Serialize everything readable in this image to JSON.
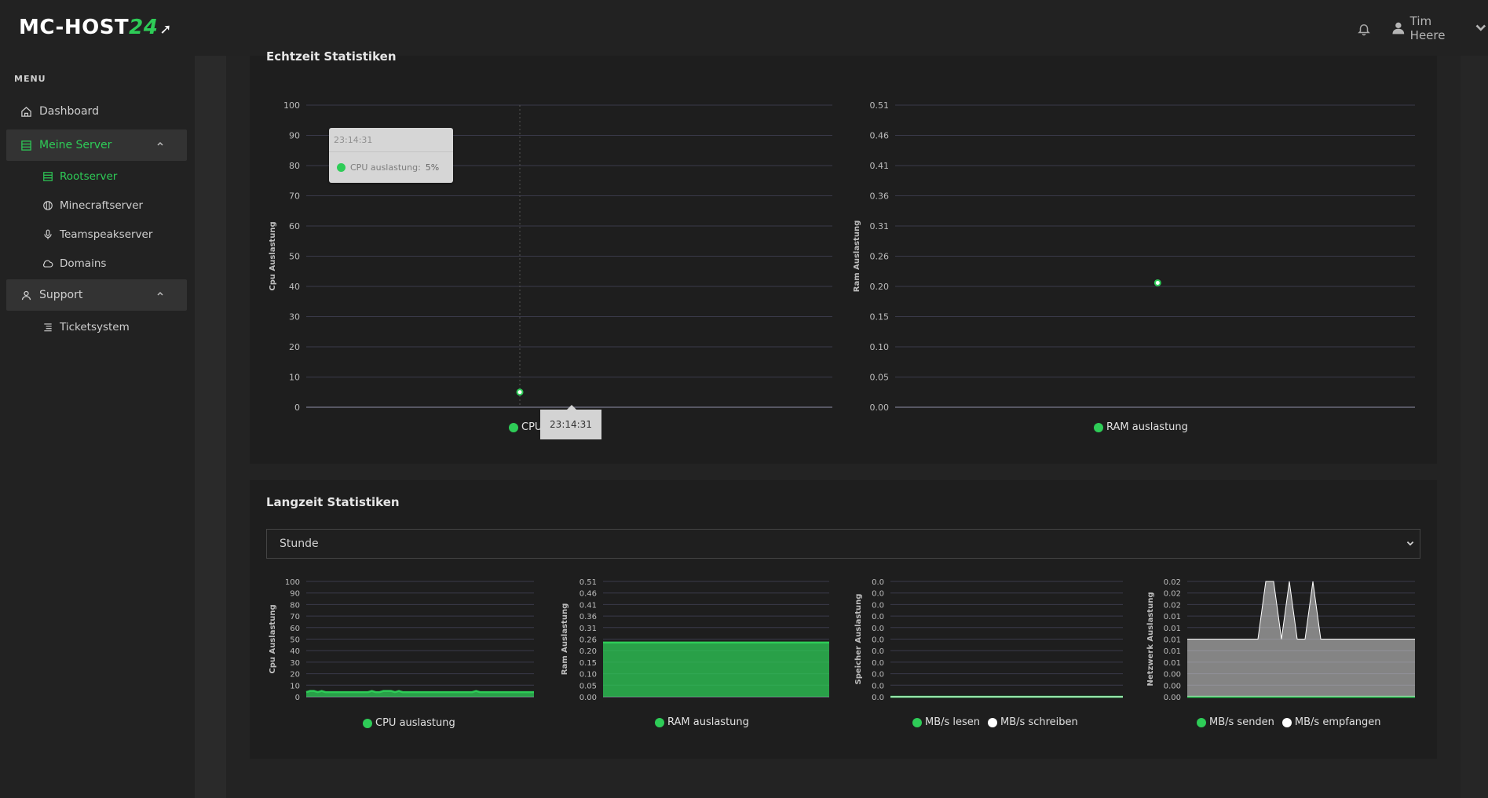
{
  "header": {
    "logo_text": "MC-HOST",
    "logo_accent": "24",
    "user_name": "Tim Heere",
    "icons": [
      "bell-icon",
      "user-icon",
      "chevron-down-icon"
    ]
  },
  "sidebar": {
    "menu_label": "MENU",
    "items": [
      {
        "label": "Dashboard",
        "icon": "home-icon"
      },
      {
        "label": "Meine Server",
        "icon": "server-icon"
      },
      {
        "label": "Rootserver",
        "icon": "server-icon"
      },
      {
        "label": "Minecraftserver",
        "icon": "ball-icon"
      },
      {
        "label": "Teamspeakserver",
        "icon": "microphone-icon"
      },
      {
        "label": "Domains",
        "icon": "cloud-icon"
      },
      {
        "label": "Support",
        "icon": "user-icon"
      },
      {
        "label": "Ticketsystem",
        "icon": "list-icon"
      }
    ]
  },
  "realtime": {
    "title": "Echtzeit Statistiken",
    "tooltip_time": "23:14:31",
    "tooltip_series": "CPU auslastung:",
    "tooltip_value": "5%",
    "xaxis_tooltip": "23:14:31"
  },
  "longterm": {
    "title": "Langzeit Statistiken",
    "select_value": "Stunde"
  },
  "colors": {
    "accent": "#2ecc57",
    "background": "#1c1c1c",
    "card": "#1e1e1e",
    "grid": "#3a3a4a"
  },
  "chart_data": [
    {
      "type": "line",
      "ylabel": "Cpu Auslastung",
      "yticks": [
        "100",
        "90",
        "80",
        "70",
        "60",
        "50",
        "40",
        "30",
        "20",
        "10",
        "0"
      ],
      "ylim": [
        0,
        100
      ],
      "series": [
        {
          "name": "CPU auslastung",
          "color": "#2ecc57",
          "x": [
            "23:14:31"
          ],
          "values": [
            5
          ]
        }
      ]
    },
    {
      "type": "line",
      "ylabel": "Ram Auslastung",
      "yticks": [
        "0.51",
        "0.46",
        "0.41",
        "0.36",
        "0.31",
        "0.26",
        "0.20",
        "0.15",
        "0.10",
        "0.05",
        "0.00"
      ],
      "ylim": [
        0,
        0.51
      ],
      "series": [
        {
          "name": "RAM auslastung",
          "color": "#2ecc57",
          "values": [
            0.21
          ]
        }
      ]
    },
    {
      "type": "area",
      "ylabel": "Cpu Auslastung",
      "yticks": [
        "100",
        "90",
        "80",
        "70",
        "60",
        "50",
        "40",
        "30",
        "20",
        "10",
        "0"
      ],
      "ylim": [
        0,
        100
      ],
      "series": [
        {
          "name": "CPU auslastung",
          "color": "#2ecc57",
          "values": [
            4,
            5,
            5,
            4,
            5,
            4,
            4,
            4,
            4,
            4,
            4,
            4,
            4,
            4,
            4,
            4,
            4,
            5,
            4,
            4,
            5,
            5,
            5,
            4,
            5,
            4,
            4,
            4,
            4,
            4,
            4,
            4,
            4,
            4,
            4,
            4,
            4,
            4,
            4,
            4,
            4,
            4,
            4,
            4,
            5,
            4,
            4,
            4,
            4,
            4,
            4,
            4,
            4,
            4,
            4,
            4,
            4,
            4,
            4,
            4
          ]
        }
      ]
    },
    {
      "type": "area",
      "ylabel": "Ram Auslastung",
      "yticks": [
        "0.51",
        "0.46",
        "0.41",
        "0.36",
        "0.31",
        "0.26",
        "0.20",
        "0.15",
        "0.10",
        "0.05",
        "0.00"
      ],
      "ylim": [
        0,
        0.51
      ],
      "series": [
        {
          "name": "RAM auslastung",
          "color": "#2ecc57",
          "values": [
            0.24,
            0.24,
            0.24,
            0.24,
            0.24,
            0.24,
            0.24,
            0.24,
            0.24,
            0.24,
            0.24,
            0.24
          ]
        }
      ]
    },
    {
      "type": "area",
      "ylabel": "Speicher Auslastung",
      "yticks": [
        "0.0",
        "0.0",
        "0.0",
        "0.0",
        "0.0",
        "0.0",
        "0.0",
        "0.0",
        "0.0",
        "0.0",
        "0.0"
      ],
      "ylim": [
        0,
        1
      ],
      "series": [
        {
          "name": "MB/s lesen",
          "color": "#2ecc57",
          "values": [
            0,
            0,
            0,
            0,
            0,
            0,
            0,
            0,
            0,
            0,
            0,
            0
          ]
        },
        {
          "name": "MB/s schreiben",
          "color": "#ffffff",
          "values": [
            0,
            0,
            0,
            0,
            0,
            0,
            0,
            0,
            0,
            0,
            0,
            0
          ]
        }
      ]
    },
    {
      "type": "area",
      "ylabel": "Netzwerk Auslastung",
      "yticks": [
        "0.02",
        "0.02",
        "0.02",
        "0.01",
        "0.01",
        "0.01",
        "0.01",
        "0.01",
        "0.00",
        "0.00",
        "0.00"
      ],
      "ylim": [
        0,
        0.02
      ],
      "series": [
        {
          "name": "MB/s senden",
          "color": "#2ecc57",
          "values": [
            0,
            0,
            0,
            0,
            0,
            0,
            0,
            0,
            0,
            0,
            0,
            0,
            0,
            0,
            0,
            0,
            0,
            0,
            0,
            0,
            0,
            0,
            0,
            0,
            0,
            0,
            0,
            0,
            0,
            0
          ]
        },
        {
          "name": "MB/s empfangen",
          "color": "#ffffff",
          "values": [
            0.01,
            0.01,
            0.01,
            0.01,
            0.01,
            0.01,
            0.01,
            0.01,
            0.01,
            0.01,
            0.02,
            0.02,
            0.01,
            0.02,
            0.01,
            0.01,
            0.02,
            0.01,
            0.01,
            0.01,
            0.01,
            0.01,
            0.01,
            0.01,
            0.01,
            0.01,
            0.01,
            0.01,
            0.01,
            0.01
          ]
        }
      ]
    }
  ]
}
